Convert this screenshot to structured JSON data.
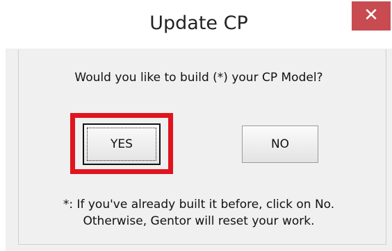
{
  "dialog": {
    "title": "Update CP",
    "close_glyph": "✕",
    "prompt": "Would you like to build (*) your CP Model?",
    "yes_label": "YES",
    "no_label": "NO",
    "note_line1": "*: If you've already built it before, click on No.",
    "note_line2": "Otherwise, Gentor will reset your work."
  },
  "colors": {
    "close_button": "#c74b50",
    "highlight": "#e0141e"
  }
}
